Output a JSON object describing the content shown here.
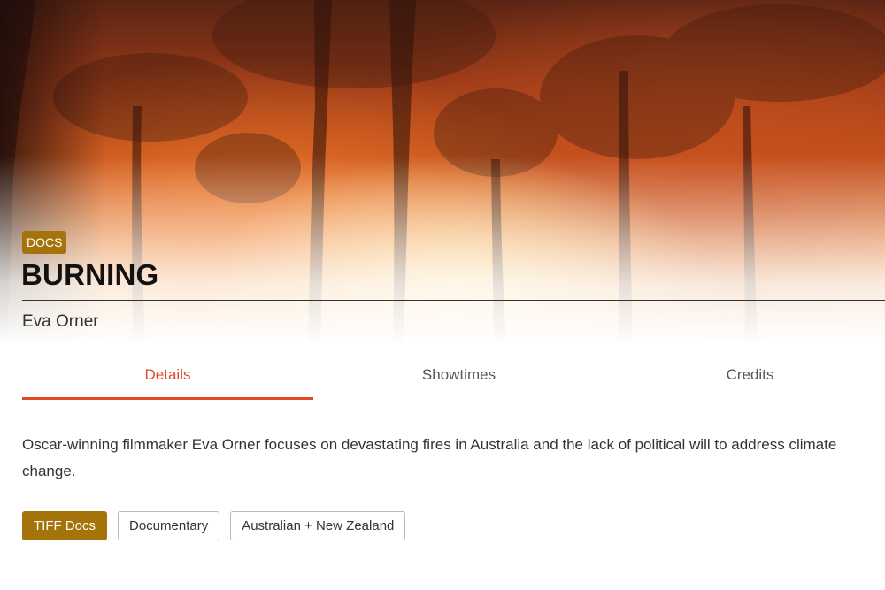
{
  "hero": {
    "image": "forest-fire-photo",
    "badge": "DOCS",
    "title": "BURNING",
    "director": "Eva Orner"
  },
  "tabs": [
    {
      "label": "Details",
      "active": true
    },
    {
      "label": "Showtimes",
      "active": false
    },
    {
      "label": "Credits",
      "active": false
    }
  ],
  "description": "Oscar-winning filmmaker Eva Orner focuses on devastating fires in Australia and the lack of political will to address climate change.",
  "tags": [
    {
      "label": "TIFF Docs",
      "primary": true
    },
    {
      "label": "Documentary",
      "primary": false
    },
    {
      "label": "Australian + New Zealand",
      "primary": false
    }
  ],
  "colors": {
    "accent": "#e0492a",
    "badge": "#a4730a"
  }
}
